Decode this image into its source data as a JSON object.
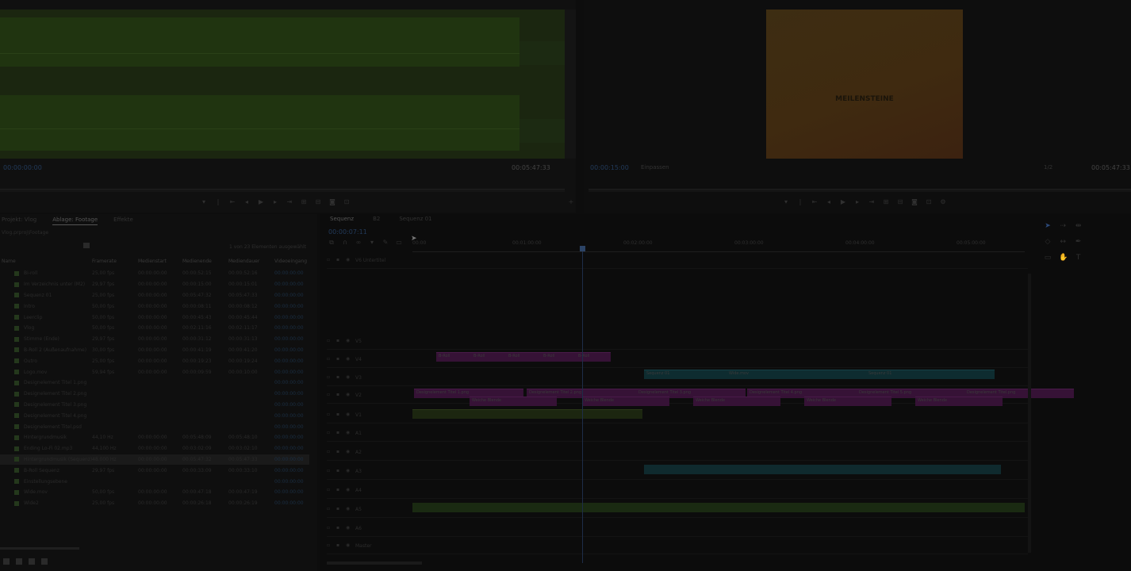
{
  "source_monitor": {
    "timecode_in": "00:00:00:00",
    "duration": "00:05:47:33"
  },
  "program_monitor": {
    "title_card": "MEILENSTEINE",
    "timecode": "00:00:15:00",
    "fit_label": "Einpassen",
    "full_label": "1/2",
    "duration": "00:05:47:33"
  },
  "project_panel": {
    "tabs": [
      "Projekt: Vlog",
      "Ablage: Footage",
      "Effekte"
    ],
    "path": "Vlog.prproj\\Footage",
    "item_count": "1 von 23 Elementen ausgewählt",
    "columns": [
      "Name",
      "Framerate",
      "Medienstart",
      "Medienende",
      "Mediendauer",
      "Videoeingang"
    ],
    "items": [
      {
        "name": "Bi-roll",
        "rate": "25,00 fps",
        "start": "00:00:00:00",
        "end": "00:00:52:15",
        "dur": "00:00:52:16",
        "vin": "00:00:00:00"
      },
      {
        "name": "Im Verzeichnis unter (M2)",
        "rate": "29,97 fps",
        "start": "00:00:00:00",
        "end": "00:00:15:00",
        "dur": "00:00:15:01",
        "vin": "00:00:00:00"
      },
      {
        "name": "Sequenz 01",
        "rate": "25,00 fps",
        "start": "00:00:00:00",
        "end": "00:05:47:32",
        "dur": "00:05:47:33",
        "vin": "00:00:00:00"
      },
      {
        "name": "Intro",
        "rate": "50,00 fps",
        "start": "00:00:00:00",
        "end": "00:00:08:11",
        "dur": "00:00:08:12",
        "vin": "00:00:00:00"
      },
      {
        "name": "Leerclip",
        "rate": "50,00 fps",
        "start": "00:00:00:00",
        "end": "00:00:45:43",
        "dur": "00:00:45:44",
        "vin": "00:00:00:00"
      },
      {
        "name": "Vlog",
        "rate": "50,00 fps",
        "start": "00:00:00:00",
        "end": "00:02:11:16",
        "dur": "00:02:11:17",
        "vin": "00:00:00:00"
      },
      {
        "name": "Stimme (Ende)",
        "rate": "29,97 fps",
        "start": "00:00:00:00",
        "end": "00:00:31:12",
        "dur": "00:00:31:13",
        "vin": "00:00:00:00"
      },
      {
        "name": "B-Roll 2 (Außenaufnahme)",
        "rate": "30,00 fps",
        "start": "00:00:00:00",
        "end": "00:00:41:19",
        "dur": "00:00:41:20",
        "vin": "00:00:00:00"
      },
      {
        "name": "Outro",
        "rate": "25,00 fps",
        "start": "00:00:00:00",
        "end": "00:00:19:23",
        "dur": "00:00:19:24",
        "vin": "00:00:00:00"
      },
      {
        "name": "Logo.mov",
        "rate": "59,94 fps",
        "start": "00:00:00:00",
        "end": "00:00:09:59",
        "dur": "00:00:10:00",
        "vin": "00:00:00:00"
      },
      {
        "name": "Designelement Titel 1.png",
        "rate": "",
        "start": "",
        "end": "",
        "dur": "",
        "vin": "00:00:00:00"
      },
      {
        "name": "Designelement Titel 2.png",
        "rate": "",
        "start": "",
        "end": "",
        "dur": "",
        "vin": "00:00:00:00"
      },
      {
        "name": "Designelement Titel 3.png",
        "rate": "",
        "start": "",
        "end": "",
        "dur": "",
        "vin": "00:00:00:00"
      },
      {
        "name": "Designelement Titel 4.png",
        "rate": "",
        "start": "",
        "end": "",
        "dur": "",
        "vin": "00:00:00:00"
      },
      {
        "name": "Designelement Titel.psd",
        "rate": "",
        "start": "",
        "end": "",
        "dur": "",
        "vin": "00:00:00:00"
      },
      {
        "name": "Hintergrundmusik",
        "rate": "44,10 Hz",
        "start": "00:00:00:00",
        "end": "00:05:48:09",
        "dur": "00:05:48:10",
        "vin": "00:00:00:00"
      },
      {
        "name": "Ending Lo-Fi 02.mp3",
        "rate": "44,100 Hz",
        "start": "00:00:00:00",
        "end": "00:03:02:09",
        "dur": "00:03:02:10",
        "vin": "00:00:00:00"
      },
      {
        "name": "Hintergrundmusik (Sequenz)",
        "rate": "48.000 Hz",
        "start": "00:00:00:00",
        "end": "00:05:47:32",
        "dur": "00:05:47:33",
        "vin": "00:00:00:00"
      },
      {
        "name": "B-Roll Sequenz",
        "rate": "29,97 fps",
        "start": "00:00:00:00",
        "end": "00:00:33:09",
        "dur": "00:00:33:10",
        "vin": "00:00:00:00"
      },
      {
        "name": "Einstellungsebene",
        "rate": "",
        "start": "",
        "end": "",
        "dur": "",
        "vin": "00:00:00:00"
      },
      {
        "name": "Wide.mov",
        "rate": "50,00 fps",
        "start": "00:00:00:00",
        "end": "00:00:47:18",
        "dur": "00:00:47:19",
        "vin": "00:00:00:00"
      },
      {
        "name": "Wide2",
        "rate": "25,00 fps",
        "start": "00:00:00:00",
        "end": "00:00:26:18",
        "dur": "00:00:26:19",
        "vin": "00:00:00:00"
      }
    ]
  },
  "timeline": {
    "tabs": [
      "Sequenz",
      "B2",
      "Sequenz 01"
    ],
    "timecode": "00:00:07:11",
    "ruler_labels": [
      "00:00",
      "00:01:00:00",
      "00:02:00:00",
      "00:03:00:00",
      "00:04:00:00",
      "00:05:00:00"
    ],
    "tracks": [
      {
        "label": "V6",
        "name": "Untertitel"
      },
      {
        "label": "V5",
        "name": ""
      },
      {
        "label": "V4",
        "name": ""
      },
      {
        "label": "V3",
        "name": ""
      },
      {
        "label": "V2",
        "name": ""
      },
      {
        "label": "V1",
        "name": ""
      },
      {
        "label": "A1",
        "name": ""
      },
      {
        "label": "A2",
        "name": ""
      },
      {
        "label": "A3",
        "name": ""
      },
      {
        "label": "A4",
        "name": ""
      },
      {
        "label": "A5",
        "name": ""
      },
      {
        "label": "A6",
        "name": ""
      },
      {
        "label": "Master",
        "name": ""
      }
    ],
    "clips": {
      "v3": [
        "B-Roll",
        "B-Roll",
        "B-Roll",
        "B-Roll",
        "B-Roll"
      ],
      "v2": [
        "Sequenz 01",
        "Wide.mov",
        "Sequenz 01"
      ],
      "v1_titles": [
        "Designelement Titel 1.png",
        "Designelement Titel 2.png",
        "Designelement Titel 3.png",
        "Designelement Titel 4.png",
        "Designelement Titel 5.png",
        "Designelement Titel.png"
      ],
      "v1_blends": [
        "Weiche Blende",
        "Weiche Blende",
        "Weiche Blende",
        "Weiche Blende",
        "Weiche Blende"
      ]
    }
  }
}
